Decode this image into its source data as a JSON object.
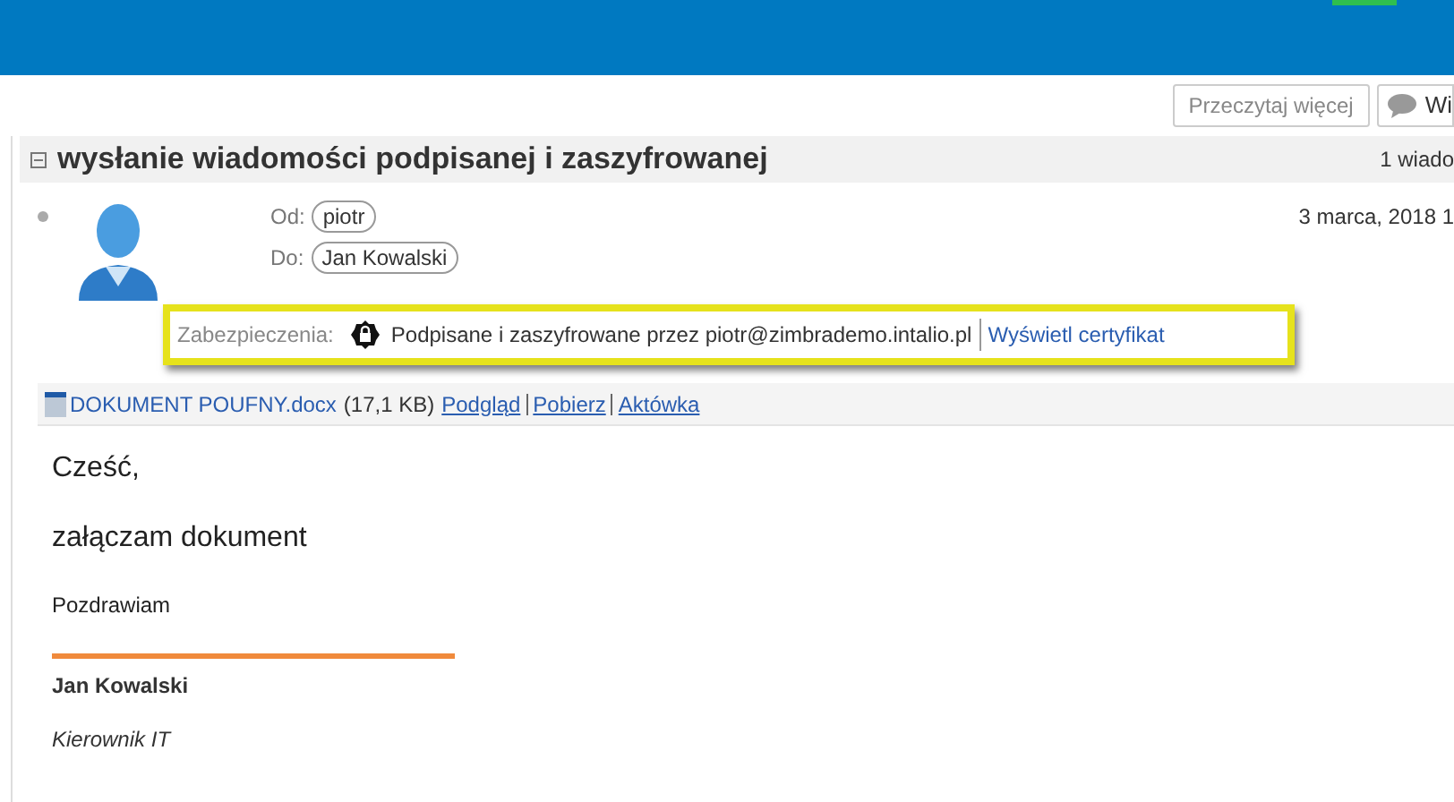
{
  "toolbar": {
    "buttons": [
      {
        "label": "Przeczytaj więcej",
        "kind": "text"
      },
      {
        "label": "Wi",
        "kind": "icon"
      }
    ]
  },
  "conversation": {
    "title": "wysłanie wiadomości podpisanej i zaszyfrowanej",
    "count": "1 wiado",
    "expanded": true
  },
  "message": {
    "unread": false,
    "date": "3 marca, 2018 1",
    "from": {
      "label": "Od:",
      "name": "piotr"
    },
    "to": {
      "label": "Do:",
      "name": "Jan Kowalski"
    },
    "security": {
      "label": "Zabezpieczenia:",
      "text": "Podpisane i zaszyfrowane przez piotr@zimbrademo.intalio.pl",
      "link": "Wyświetl certyfikat"
    },
    "attachment": {
      "name": "DOKUMENT POUFNY.docx",
      "size": "(17,1 KB)",
      "links": [
        "Podgląd",
        "Pobierz",
        "Aktówka"
      ]
    },
    "body": {
      "greeting": "Cześć,",
      "line": "załączam dokument",
      "closing": "Pozdrawiam",
      "signature_name": "Jan Kowalski",
      "signature_title": "Kierownik IT"
    }
  }
}
